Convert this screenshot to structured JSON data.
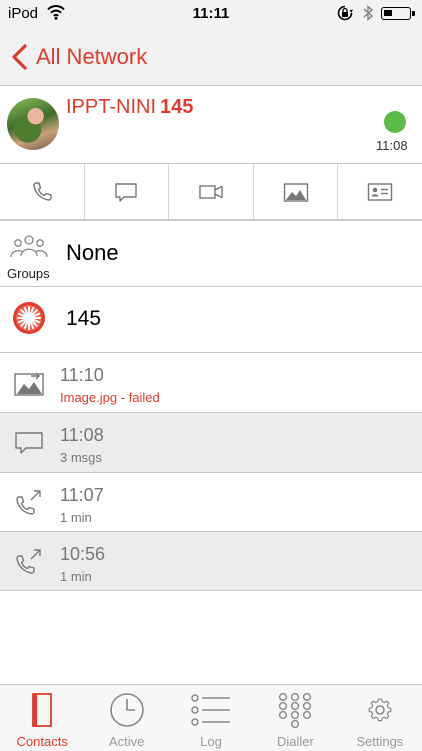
{
  "status_bar": {
    "carrier": "iPod",
    "time": "11:11"
  },
  "nav": {
    "back_label": "All Network"
  },
  "contact": {
    "name": "IPPT-NINI",
    "number": "145",
    "presence_time": "11:08",
    "presence_color": "#5bbb46"
  },
  "actions": [
    "phone-icon",
    "chat-icon",
    "video-icon",
    "image-icon",
    "contact-card-icon"
  ],
  "groups": {
    "label": "Groups",
    "value": "None"
  },
  "number_row": {
    "value": "145"
  },
  "log": [
    {
      "icon": "image-transfer-icon",
      "time": "11:10",
      "detail": "Image.jpg - failed"
    },
    {
      "icon": "chat-icon",
      "time": "11:08",
      "detail": "3 msgs"
    },
    {
      "icon": "outgoing-call-icon",
      "time": "11:07",
      "detail": "1 min"
    },
    {
      "icon": "outgoing-call-icon",
      "time": "10:56",
      "detail": "1 min"
    }
  ],
  "tabs": [
    {
      "label": "Contacts",
      "icon": "contacts-icon",
      "active": true
    },
    {
      "label": "Active",
      "icon": "clock-icon",
      "active": false
    },
    {
      "label": "Log",
      "icon": "list-icon",
      "active": false
    },
    {
      "label": "Dialler",
      "icon": "keypad-icon",
      "active": false
    },
    {
      "label": "Settings",
      "icon": "gear-icon",
      "active": false
    }
  ],
  "colors": {
    "accent": "#e03b2c",
    "divider": "#c8c8c8",
    "muted": "#777777"
  }
}
